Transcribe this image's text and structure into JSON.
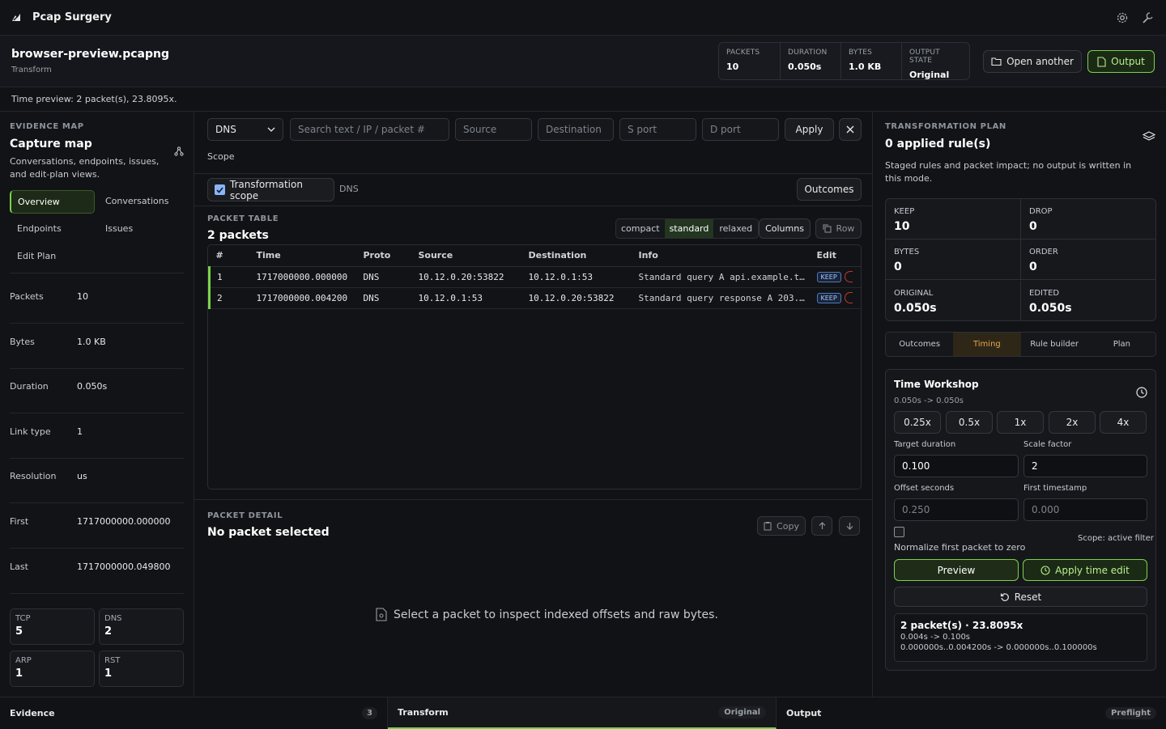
{
  "app": {
    "title": "Pcap Surgery"
  },
  "file": {
    "name": "browser-preview.pcapng",
    "mode": "Transform"
  },
  "stats": [
    {
      "label": "PACKETS",
      "value": "10"
    },
    {
      "label": "DURATION",
      "value": "0.050s"
    },
    {
      "label": "BYTES",
      "value": "1.0 KB"
    },
    {
      "label": "OUTPUT STATE",
      "value": "Original"
    }
  ],
  "header_actions": {
    "open_another": "Open another",
    "output": "Output"
  },
  "time_preview": "Time preview: 2 packet(s), 23.8095x.",
  "evidence": {
    "section": "EVIDENCE MAP",
    "title": "Capture map",
    "desc": "Conversations, endpoints, issues, and edit-plan views.",
    "nav": [
      "Overview",
      "Conversations",
      "Endpoints",
      "Issues",
      "Edit Plan"
    ],
    "summary": [
      {
        "k": "Packets",
        "v": "10"
      },
      {
        "k": "Bytes",
        "v": "1.0 KB"
      },
      {
        "k": "Duration",
        "v": "0.050s"
      },
      {
        "k": "Link type",
        "v": "1"
      },
      {
        "k": "Resolution",
        "v": "us"
      },
      {
        "k": "First",
        "v": "1717000000.000000"
      },
      {
        "k": "Last",
        "v": "1717000000.049800"
      }
    ],
    "counts": [
      {
        "label": "TCP",
        "value": "5"
      },
      {
        "label": "DNS",
        "value": "2"
      },
      {
        "label": "ARP",
        "value": "1"
      },
      {
        "label": "RST",
        "value": "1"
      }
    ]
  },
  "filter": {
    "protocol": "DNS",
    "search_placeholder": "Search text / IP / packet #",
    "source_placeholder": "Source",
    "destination_placeholder": "Destination",
    "sport_placeholder": "S port",
    "dport_placeholder": "D port",
    "apply": "Apply",
    "scope_label": "Scope",
    "scope_checkbox": "Transformation scope",
    "scope_tag": "DNS",
    "outcomes": "Outcomes"
  },
  "packet_table": {
    "section": "PACKET TABLE",
    "title": "2 packets",
    "density": [
      "compact",
      "standard",
      "relaxed"
    ],
    "columns_btn": "Columns",
    "row_btn": "Row",
    "headers": [
      "#",
      "Time",
      "Proto",
      "Source",
      "Destination",
      "Info",
      "Edit"
    ],
    "rows": [
      {
        "num": "1",
        "time": "1717000000.000000",
        "proto": "DNS",
        "source": "10.12.0.20:53822",
        "dest": "10.12.0.1:53",
        "info": "Standard query A api.example.t…",
        "edit": "KEEP"
      },
      {
        "num": "2",
        "time": "1717000000.004200",
        "proto": "DNS",
        "source": "10.12.0.1:53",
        "dest": "10.12.0.20:53822",
        "info": "Standard query response A 203.…",
        "edit": "KEEP"
      }
    ]
  },
  "packet_detail": {
    "section": "PACKET DETAIL",
    "title": "No packet selected",
    "copy": "Copy",
    "empty": "Select a packet to inspect indexed offsets and raw bytes."
  },
  "plan": {
    "section": "TRANSFORMATION PLAN",
    "title": "0 applied rule(s)",
    "desc": "Staged rules and packet impact; no output is written in this mode.",
    "cells": [
      {
        "label": "KEEP",
        "value": "10"
      },
      {
        "label": "DROP",
        "value": "0"
      },
      {
        "label": "BYTES",
        "value": "0"
      },
      {
        "label": "ORDER",
        "value": "0"
      },
      {
        "label": "ORIGINAL",
        "value": "0.050s"
      },
      {
        "label": "EDITED",
        "value": "0.050s"
      }
    ],
    "tabs": [
      "Outcomes",
      "Timing",
      "Rule builder",
      "Plan"
    ]
  },
  "time_workshop": {
    "title": "Time Workshop",
    "sub": "0.050s -> 0.050s",
    "speeds": [
      "0.25x",
      "0.5x",
      "1x",
      "2x",
      "4x"
    ],
    "target_label": "Target duration",
    "target_value": "0.100",
    "scale_label": "Scale factor",
    "scale_value": "2",
    "offset_label": "Offset seconds",
    "offset_placeholder": "0.250",
    "first_label": "First timestamp",
    "first_placeholder": "0.000",
    "scope_note": "Scope: active filter",
    "normalize": "Normalize first packet to zero",
    "preview": "Preview",
    "apply": "Apply time edit",
    "reset": "Reset",
    "result_title": "2 packet(s) · 23.8095x",
    "result_line1": "0.004s -> 0.100s",
    "result_line2": "0.000000s..0.004200s -> 0.000000s..0.100000s"
  },
  "footer": {
    "evidence": "Evidence",
    "evidence_count": "3",
    "transform": "Transform",
    "transform_state": "Original",
    "output": "Output",
    "output_state": "Preflight"
  },
  "colors": {
    "accent_green": "#7bd24a",
    "accent_orange": "#e8a54b",
    "background": "#101114"
  }
}
